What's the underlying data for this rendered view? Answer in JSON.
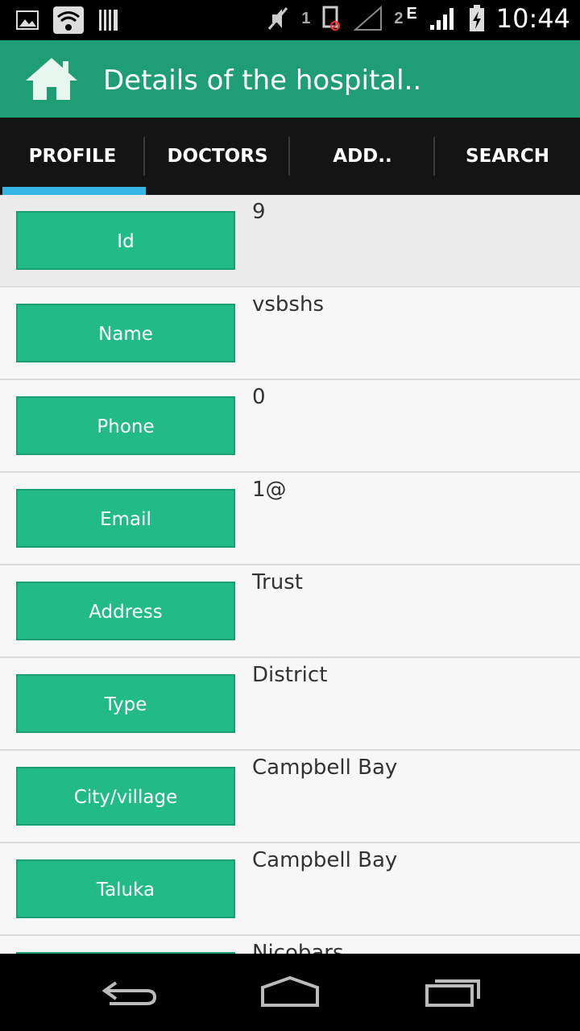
{
  "status_bar": {
    "sim1": "1",
    "sim2": "2",
    "network_type": "E",
    "time": "10:44"
  },
  "header": {
    "title": "Details of the hospital..",
    "icon": "home-icon"
  },
  "tabs": [
    {
      "label": "PROFILE",
      "selected": true
    },
    {
      "label": "DOCTORS",
      "selected": false
    },
    {
      "label": "ADD..",
      "selected": false
    },
    {
      "label": "SEARCH",
      "selected": false
    }
  ],
  "fields": [
    {
      "label": "Id",
      "value": "9"
    },
    {
      "label": "Name",
      "value": "vsbshs"
    },
    {
      "label": "Phone",
      "value": "0"
    },
    {
      "label": "Email",
      "value": "1@"
    },
    {
      "label": "Address",
      "value": "Trust"
    },
    {
      "label": "Type",
      "value": "District"
    },
    {
      "label": "City/village",
      "value": "Campbell Bay"
    },
    {
      "label": "Taluka",
      "value": "Campbell Bay"
    },
    {
      "label": "",
      "value": "Nicobars"
    }
  ],
  "colors": {
    "action_bar": "#1f9e76",
    "field_button": "#22bb88",
    "tab_indicator": "#33b5e5"
  }
}
